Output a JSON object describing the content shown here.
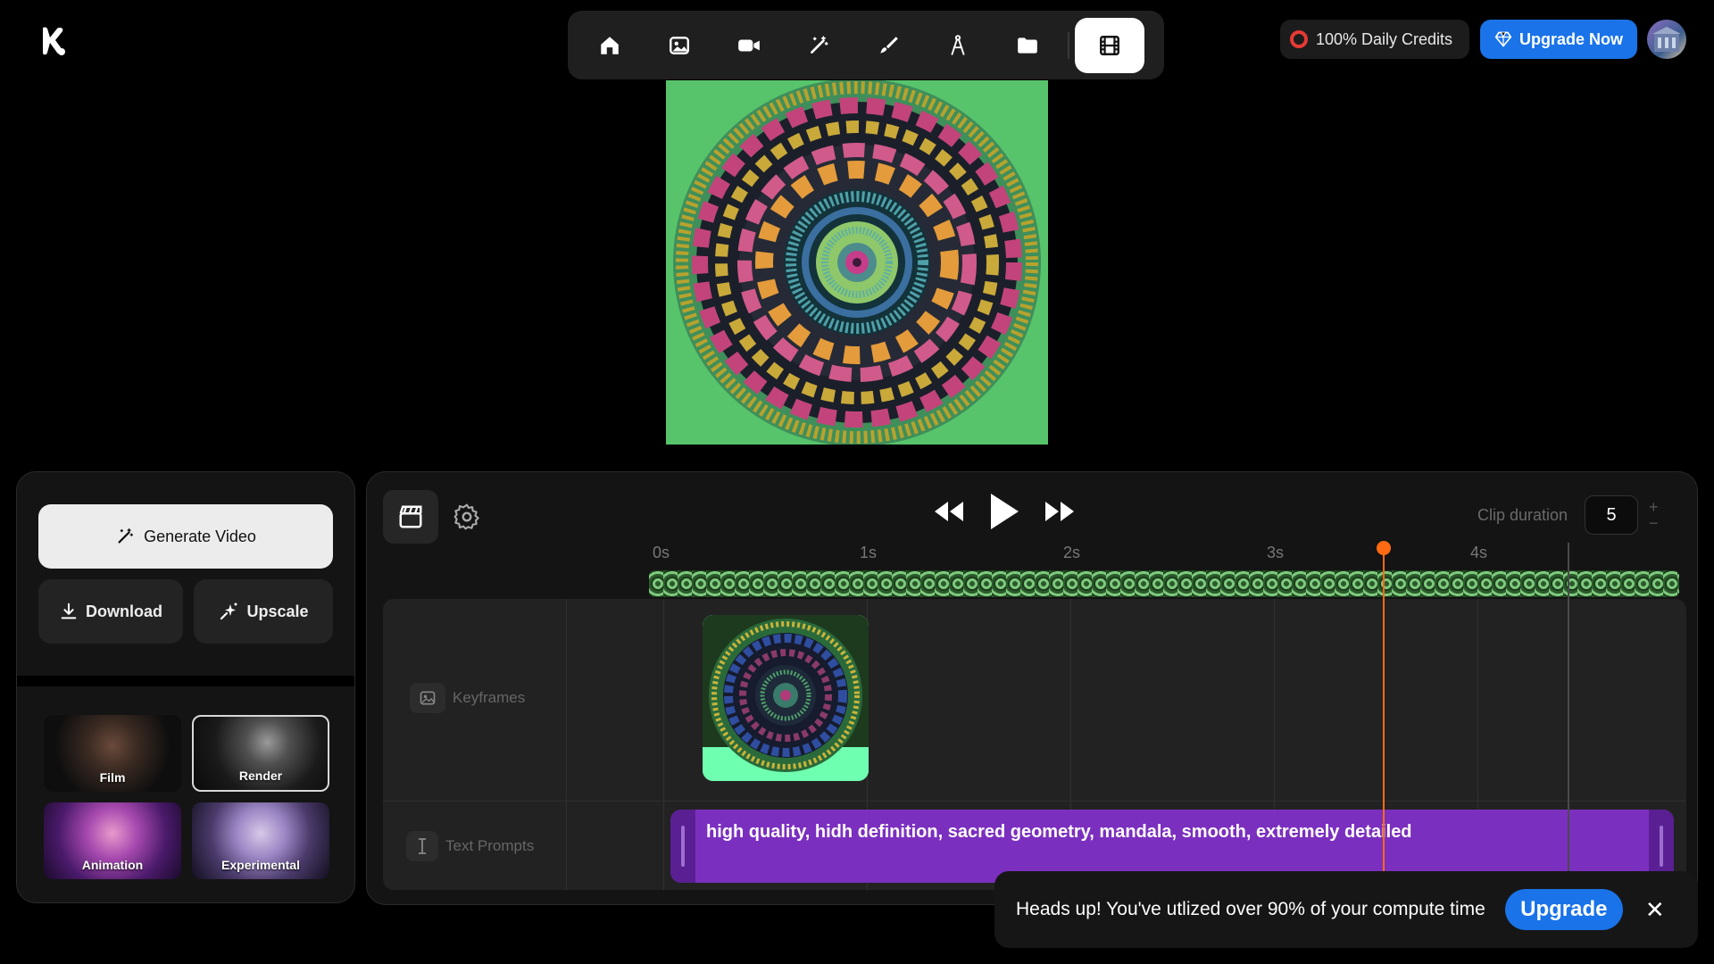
{
  "topbar": {
    "credits_label": "100% Daily Credits",
    "upgrade_label": "Upgrade Now",
    "nav_items": [
      {
        "icon": "home-icon"
      },
      {
        "icon": "image-icon"
      },
      {
        "icon": "video-camera-icon"
      },
      {
        "icon": "magic-wand-icon"
      },
      {
        "icon": "brush-icon"
      },
      {
        "icon": "compass-tool-icon"
      },
      {
        "icon": "folder-icon"
      },
      {
        "icon": "film-icon",
        "active": true
      }
    ],
    "accent_color": "#1a73e8"
  },
  "left_panel": {
    "generate_label": "Generate Video",
    "download_label": "Download",
    "upscale_label": "Upscale",
    "styles": [
      {
        "label": "Film",
        "selected": false
      },
      {
        "label": "Render",
        "selected": true
      },
      {
        "label": "Animation",
        "selected": false
      },
      {
        "label": "Experimental",
        "selected": false
      }
    ]
  },
  "timeline": {
    "clip_duration_label": "Clip duration",
    "clip_duration_value": "5",
    "ticks": [
      "0s",
      "1s",
      "2s",
      "3s",
      "4s"
    ],
    "tracks": {
      "keyframes_label": "Keyframes",
      "text_prompts_label": "Text Prompts"
    },
    "prompt_text": "high quality, hidh definition, sacred geometry, mandala, smooth, extremely detailed",
    "playhead_color": "#ff6a13"
  },
  "toast": {
    "message": "Heads up! You've utlized over 90% of your compute time",
    "button_label": "Upgrade"
  }
}
